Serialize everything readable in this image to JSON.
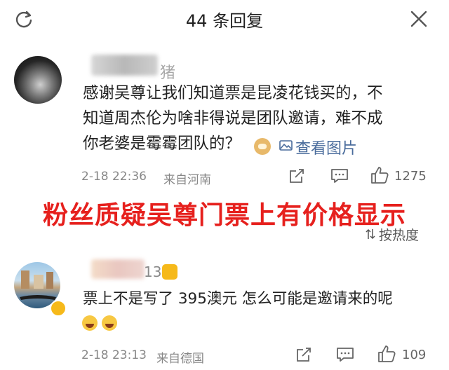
{
  "header": {
    "title": "44 条回复",
    "refresh_icon": "refresh-icon",
    "close_icon": "close-icon"
  },
  "comments": [
    {
      "username_visible": "猪",
      "text_lines": [
        "感谢吴尊让我们知道票是昆凌花钱买的，不",
        "知道周杰伦为啥非得说是团队邀请，难不成",
        "你老婆是霉霉团队的？"
      ],
      "view_image_label": "查看图片",
      "date_time": "2-18 22:36",
      "location": "来自河南",
      "like_count": "1275"
    },
    {
      "username_visible": "13",
      "text_lines": [
        "票上不是写了 395澳元 怎么可能是邀请来的呢"
      ],
      "date_time": "2-18 23:13",
      "location": "来自德国",
      "like_count": "109"
    }
  ],
  "banner": "粉丝质疑吴尊门票上有价格显示",
  "sort_label": "按热度",
  "colors": {
    "banner": "#e6201d",
    "link": "#4a6c9c",
    "meta": "#888888",
    "badge": "#f6b91a"
  }
}
